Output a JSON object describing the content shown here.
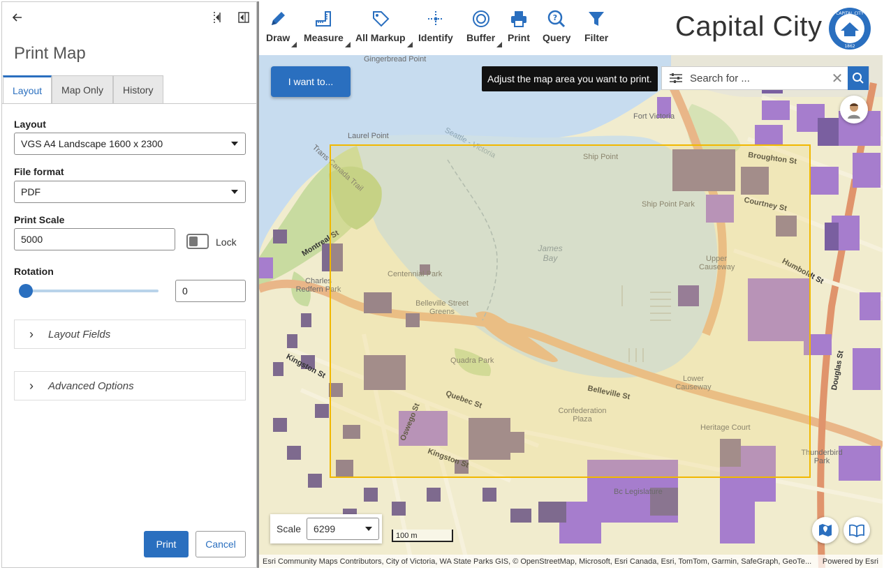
{
  "panel": {
    "title": "Print Map",
    "tabs": [
      {
        "label": "Layout",
        "active": true
      },
      {
        "label": "Map Only",
        "active": false
      },
      {
        "label": "History",
        "active": false
      }
    ],
    "layout": {
      "label": "Layout",
      "value": "VGS A4 Landscape 1600 x 2300"
    },
    "file_format": {
      "label": "File format",
      "value": "PDF"
    },
    "print_scale": {
      "label": "Print Scale",
      "value": "5000",
      "lock_label": "Lock",
      "locked": false
    },
    "rotation": {
      "label": "Rotation",
      "value": "0",
      "slider_fraction": 0
    },
    "sections": [
      {
        "label": "Layout Fields",
        "expanded": false
      },
      {
        "label": "Advanced Options",
        "expanded": false
      }
    ],
    "print_button": "Print",
    "cancel_button": "Cancel"
  },
  "toolbar": {
    "tools": [
      {
        "label": "Draw",
        "icon": "pencil-icon",
        "has_menu": true
      },
      {
        "label": "Measure",
        "icon": "ruler-icon",
        "has_menu": true
      },
      {
        "label": "All Markup",
        "icon": "markup-tag-icon",
        "has_menu": true
      },
      {
        "label": "Identify",
        "icon": "identify-crosshair-icon",
        "has_menu": false
      },
      {
        "label": "Buffer",
        "icon": "buffer-icon",
        "has_menu": true
      },
      {
        "label": "Print",
        "icon": "printer-icon",
        "has_menu": false
      },
      {
        "label": "Query",
        "icon": "query-magnifier-icon",
        "has_menu": false
      },
      {
        "label": "Filter",
        "icon": "funnel-icon",
        "has_menu": false
      }
    ],
    "app_title": "Capital City",
    "seal": {
      "top_text": "CAPITAL CITY",
      "year": "1862"
    }
  },
  "map": {
    "i_want_to": "I want to...",
    "tooltip": "Adjust the map area you want to print.",
    "search_placeholder": "Search for ...",
    "scale_label": "Scale",
    "scale_value": "6299",
    "scalebar_label": "100 m",
    "attribution": "Esri Community Maps Contributors, City of Victoria, WA State Parks GIS, © OpenStreetMap, Microsoft, Esri Canada, Esri, TomTom, Garmin, SafeGraph, GeoTe...",
    "powered_by": "Powered by Esri",
    "place_labels": [
      "Laurel Point",
      "Ship Point",
      "Ship Point Park",
      "James Bay",
      "Upper Causeway",
      "Lower Causeway",
      "Centennial Park",
      "Belleville Street Greens",
      "Quadra Park",
      "Confederation Plaza",
      "Heritage Court",
      "Thunderbird Park",
      "Charles Redfern Park",
      "Fort Victoria",
      "Broughton St",
      "Courtney St",
      "Humboldt St",
      "Belleville St",
      "Quebec St",
      "Kingston St",
      "Oswego St",
      "Montreal St",
      "Douglas St",
      "Bc Legislature",
      "Trans Canada Trail",
      "Seattle - Victoria",
      "Kingston St",
      "Gingerbread Point"
    ],
    "colors": {
      "accent": "#2a6fbf",
      "print_frame": "#f1b800",
      "water": "#c7dcef",
      "land": "#f1ecce"
    }
  }
}
